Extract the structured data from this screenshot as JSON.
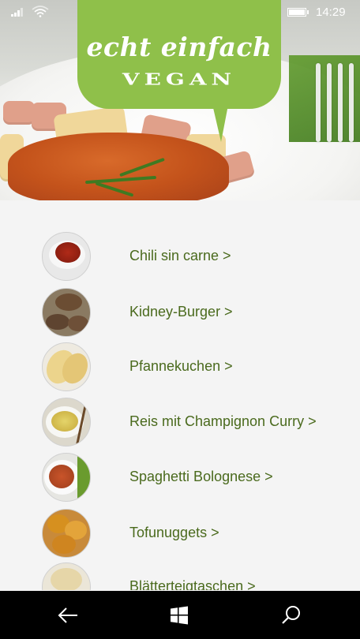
{
  "status_bar": {
    "time": "14:29"
  },
  "logo": {
    "line1": "echt einfach",
    "line2": "VEGAN"
  },
  "recipes": [
    {
      "label": "Chili sin carne >"
    },
    {
      "label": "Kidney-Burger >"
    },
    {
      "label": "Pfannekuchen >"
    },
    {
      "label": "Reis mit Champignon Curry >"
    },
    {
      "label": "Spaghetti Bolognese >"
    },
    {
      "label": "Tofunuggets >"
    },
    {
      "label": "Blätterteigtaschen >"
    }
  ],
  "nav": {
    "back_icon": "back-arrow-icon",
    "home_icon": "windows-logo-icon",
    "search_icon": "search-icon"
  },
  "colors": {
    "brand_green": "#8fc04a",
    "label_green": "#4a6a1d",
    "nav_bg": "#000000"
  }
}
